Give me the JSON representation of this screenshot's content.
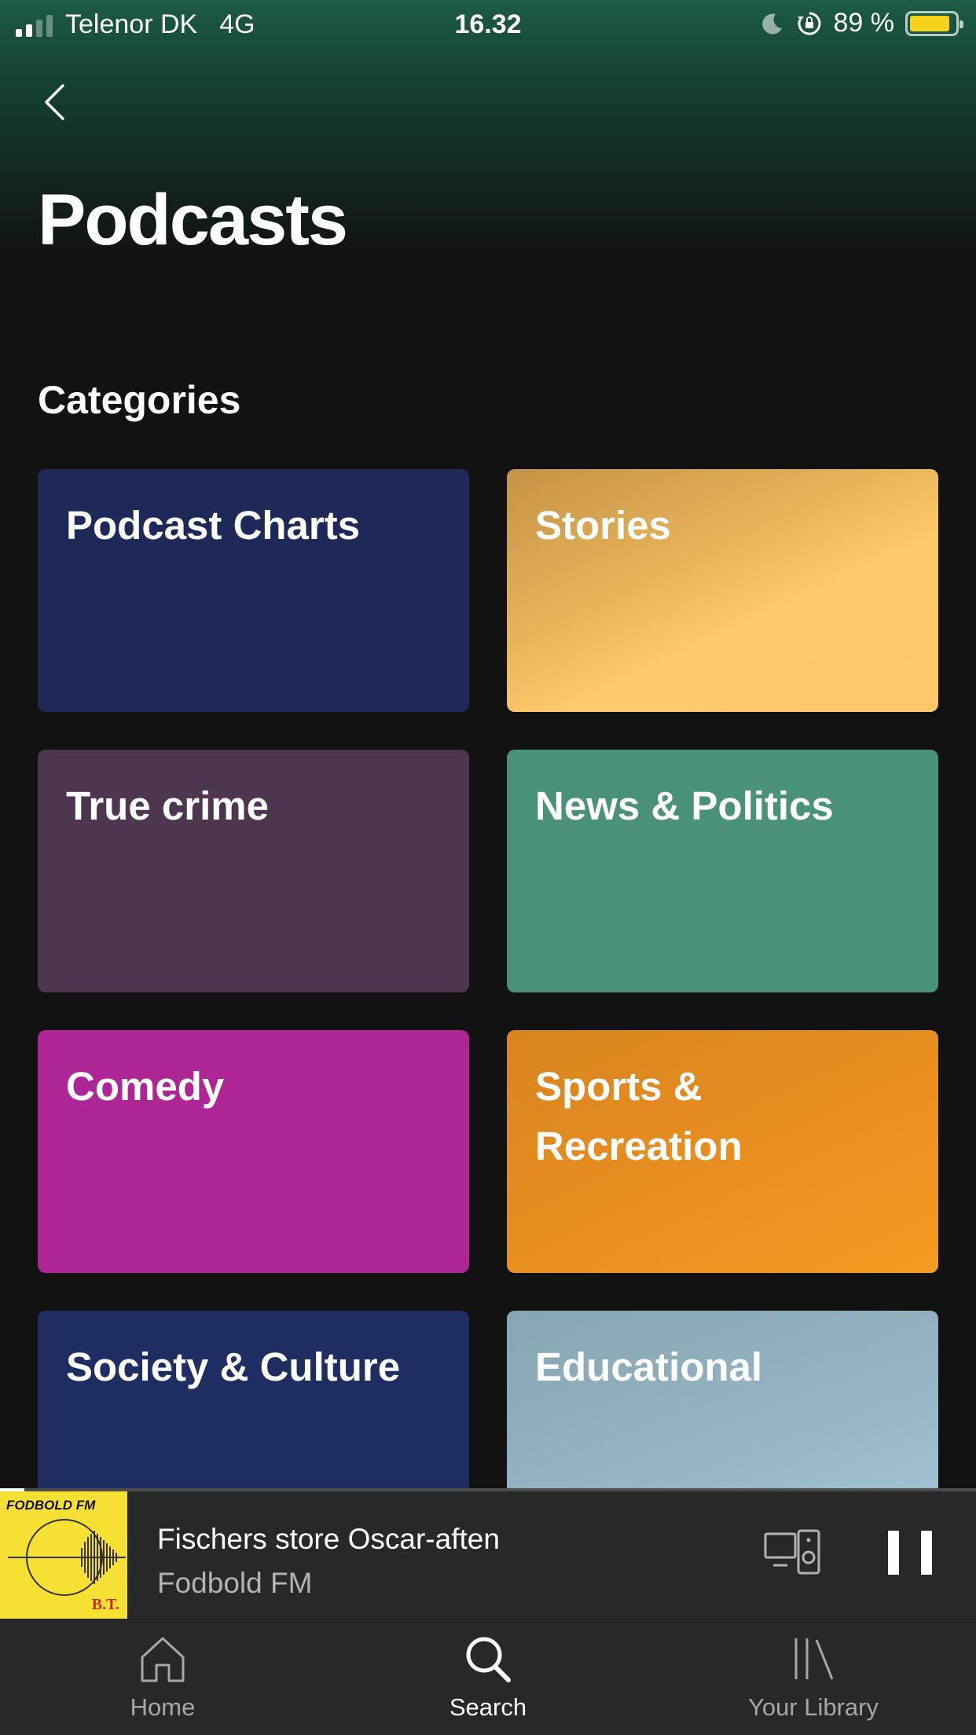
{
  "status_bar": {
    "carrier": "Telenor DK",
    "network": "4G",
    "time": "16.32",
    "battery": "89 %",
    "battery_level": 0.89,
    "battery_color": "#f5d31d"
  },
  "header": {
    "back_icon": "chevron-left-icon",
    "title": "Podcasts"
  },
  "categories": {
    "title": "Categories",
    "items": [
      {
        "label": "Podcast Charts",
        "color": "#1e295a"
      },
      {
        "label": "Stories",
        "color": "#f4bc5a"
      },
      {
        "label": "True crime",
        "color": "#4e3650"
      },
      {
        "label": "News & Politics",
        "color": "#4a917c"
      },
      {
        "label": "Comedy",
        "color": "#ae2596"
      },
      {
        "label": "Sports & Recreation",
        "color": "#ee9222"
      },
      {
        "label": "Society & Culture",
        "color": "#1e2e62"
      },
      {
        "label": "Educational",
        "color": "#95b4c3"
      }
    ]
  },
  "player": {
    "art_text": "FODBOLD FM",
    "art_brand": "B.T.",
    "title": "Fischers store Oscar-aften",
    "subtitle": "Fodbold FM",
    "progress": 0.025,
    "devices_icon": "devices-icon",
    "pause_icon": "pause-icon"
  },
  "tabbar": {
    "home": "Home",
    "search": "Search",
    "library": "Your Library",
    "active": "search"
  }
}
